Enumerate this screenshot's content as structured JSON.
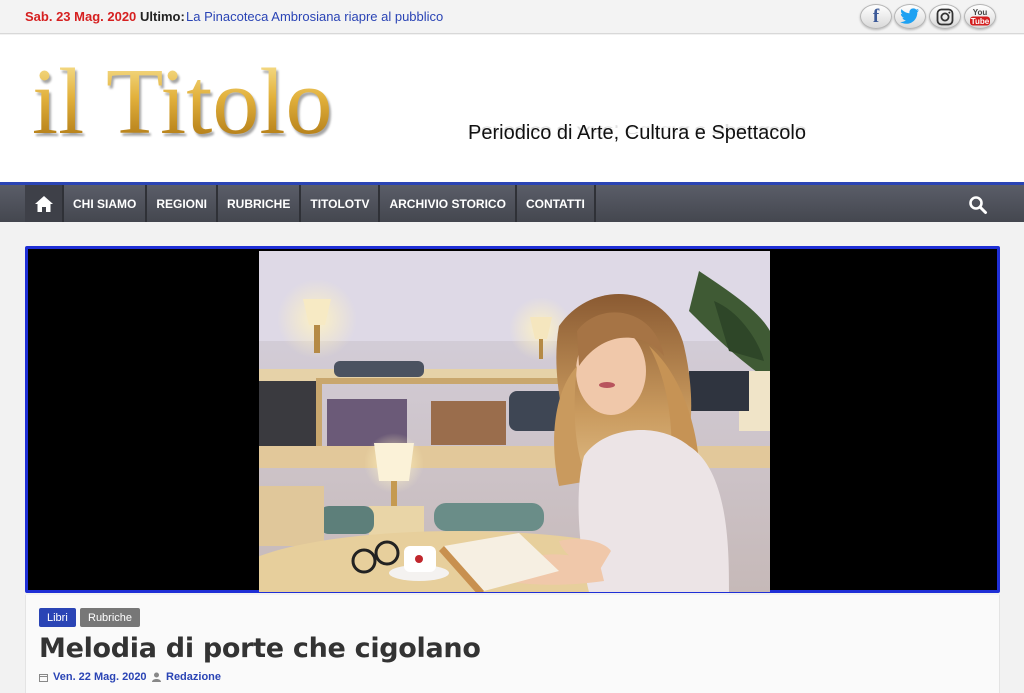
{
  "topbar": {
    "date": "Sab. 23 Mag. 2020",
    "ticker_label": "Ultimo:",
    "ticker_headline": "La Pinacoteca Ambrosiana riapre al pubblico",
    "social": [
      "facebook-icon",
      "twitter-icon",
      "instagram-icon",
      "youtube-icon"
    ],
    "youtube_text": "You Tube"
  },
  "header": {
    "logo": "il Titolo",
    "tagline": "Periodico di Arte, Cultura e Spettacolo"
  },
  "nav": {
    "items": [
      "CHI SIAMO",
      "REGIONI",
      "RUBRICHE",
      "TITOLOTV",
      "ARCHIVIO STORICO",
      "CONTATTI"
    ]
  },
  "article": {
    "categories": [
      "Libri",
      "Rubriche"
    ],
    "title": "Melodia di porte che cigolano",
    "date": "Ven. 22 Mag. 2020",
    "author": "Redazione"
  },
  "colors": {
    "accent": "#2a44b5",
    "date_red": "#d62020",
    "nav_bg": "#4e515a",
    "frame_border": "#1f2fd6"
  }
}
